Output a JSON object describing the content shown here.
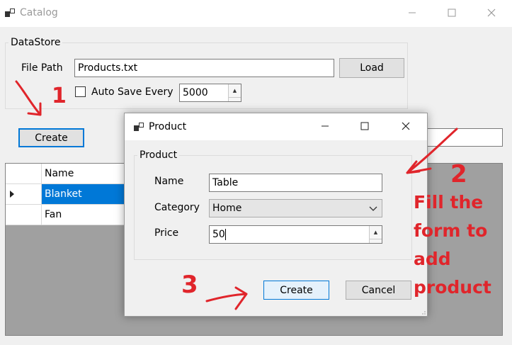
{
  "window": {
    "title": "Catalog",
    "minimize_icon": "minimize-icon",
    "maximize_icon": "maximize-icon",
    "close_icon": "close-icon"
  },
  "datastore": {
    "group_label": "DataStore",
    "file_path_label": "File Path",
    "file_path_value": "Products.txt",
    "load_label": "Load",
    "auto_save_label": "Auto Save Every",
    "auto_save_checked": false,
    "auto_save_value": "5000"
  },
  "toolbar": {
    "create_label": "Create",
    "search_value": ""
  },
  "grid": {
    "columns": [
      "Name"
    ],
    "rows": [
      {
        "name": "Blanket",
        "selected": true
      },
      {
        "name": "Fan",
        "selected": false
      }
    ]
  },
  "dialog": {
    "title": "Product",
    "group_label": "Product",
    "name_label": "Name",
    "name_value": "Table",
    "category_label": "Category",
    "category_value": "Home",
    "price_label": "Price",
    "price_value": "50",
    "create_label": "Create",
    "cancel_label": "Cancel"
  },
  "annotations": {
    "step1": "1",
    "step2": "2",
    "step2_text": [
      "Fill the",
      "form to",
      "add",
      "product"
    ],
    "step3": "3",
    "color": "#e0252b"
  },
  "colors": {
    "selection": "#0078d7",
    "grid_background": "#a0a0a0",
    "window_background": "#f0f0f0"
  }
}
